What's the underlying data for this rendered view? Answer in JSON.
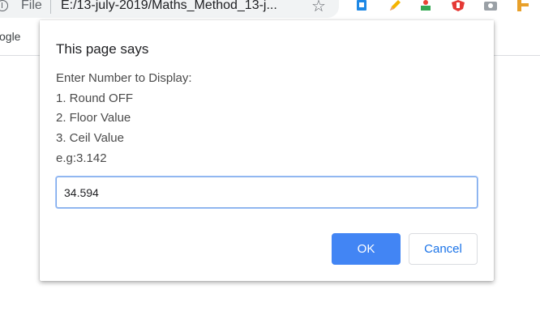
{
  "browser": {
    "file_label": "File",
    "url": "E:/13-july-2019/Maths_Method_13-j...",
    "bookmark_partial": "ogle",
    "icons": [
      "info-icon",
      "star-icon",
      "extension-icon",
      "pencil-icon",
      "extension-icon",
      "shield-icon",
      "camera-icon",
      "extension-icon"
    ]
  },
  "dialog": {
    "title": "This page says",
    "message_lines": [
      "Enter Number to Display:",
      "1. Round OFF",
      "2. Floor Value",
      "3. Ceil Value",
      "e.g:3.142"
    ],
    "input_value": "34.594",
    "ok_label": "OK",
    "cancel_label": "Cancel"
  },
  "colors": {
    "primary_button": "#4285f4",
    "cancel_text": "#1a73e8",
    "input_focus_border": "#7aa7e8"
  }
}
